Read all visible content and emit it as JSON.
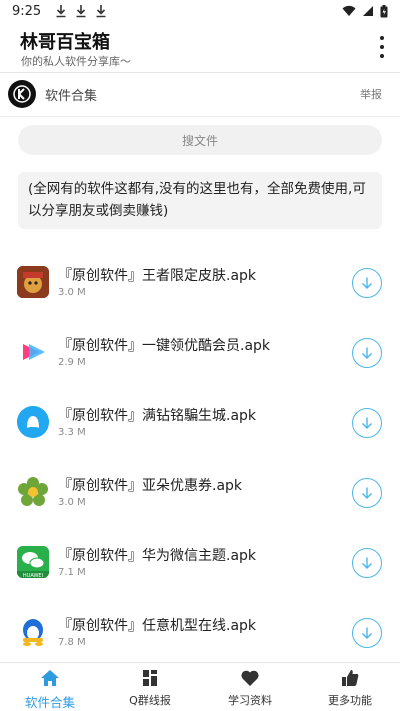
{
  "status_bar": {
    "time": "9:25"
  },
  "app_bar": {
    "title": "林哥百宝箱",
    "subtitle": "你的私人软件分享库～"
  },
  "section": {
    "title": "软件合集",
    "report_label": "举报"
  },
  "search": {
    "placeholder": "搜文件"
  },
  "notice": {
    "text": "(全网有的软件这都有,没有的这里也有，全部免费使用,可以分享朋友或倒卖赚钱)"
  },
  "files": [
    {
      "name": "『原创软件』王者限定皮肤.apk",
      "size": "3.0 M",
      "icon": "honor-of-kings-icon"
    },
    {
      "name": "『原创软件』一键领优酷会员.apk",
      "size": "2.9 M",
      "icon": "youku-icon"
    },
    {
      "name": "『原创软件』满钻铭騙生城.apk",
      "size": "3.3 M",
      "icon": "qq-icon"
    },
    {
      "name": "『原创软件』亚朵优惠券.apk",
      "size": "3.0 M",
      "icon": "flower-icon"
    },
    {
      "name": "『原创软件』华为微信主题.apk",
      "size": "7.1 M",
      "icon": "wechat-huawei-icon"
    },
    {
      "name": "『原创软件』任意机型在线.apk",
      "size": "7.8 M",
      "icon": "qq-penguin-icon"
    }
  ],
  "bottom_nav": [
    {
      "label": "软件合集",
      "icon": "home-icon",
      "active": true
    },
    {
      "label": "Q群线报",
      "icon": "grid-icon",
      "active": false
    },
    {
      "label": "学习资料",
      "icon": "heart-icon",
      "active": false
    },
    {
      "label": "更多功能",
      "icon": "thumbs-up-icon",
      "active": false
    }
  ],
  "colors": {
    "accent": "#2e9be0",
    "download": "#4bb6ea"
  }
}
